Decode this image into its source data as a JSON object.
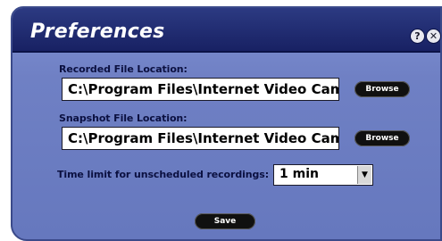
{
  "window": {
    "title": "Preferences",
    "help_glyph": "?",
    "close_glyph": "✕"
  },
  "recorded": {
    "label": "Recorded File Location:",
    "path": "C:\\Program Files\\Internet Video Camer",
    "browse_label": "Browse"
  },
  "snapshot": {
    "label": "Snapshot File Location:",
    "path": "C:\\Program Files\\Internet Video Camer",
    "browse_label": "Browse"
  },
  "time_limit": {
    "label": "Time limit for unscheduled recordings:",
    "selected": "1 min",
    "arrow": "▼"
  },
  "actions": {
    "save_label": "Save"
  },
  "colors": {
    "panel": "#7586c8",
    "titlebar": "#1f2a6e",
    "button": "#101010"
  }
}
